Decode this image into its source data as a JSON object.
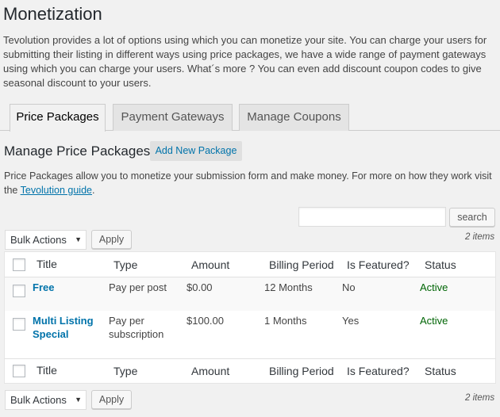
{
  "page": {
    "title": "Monetization",
    "intro": "Tevolution provides a lot of options using which you can monetize your site. You can charge your users for submitting their listing in different ways using price packages, we have a wide range of payment gateways using which you can charge your users. What´s more ? You can even add discount coupon codes to give seasonal discount to your users."
  },
  "tabs": [
    {
      "label": "Price Packages",
      "active": true
    },
    {
      "label": "Payment Gateways",
      "active": false
    },
    {
      "label": "Manage Coupons",
      "active": false
    }
  ],
  "section": {
    "title": "Manage Price Packages",
    "add_new_label": "Add New Package",
    "desc_prefix": "Price Packages allow you to monetize your submission form and make money. For more on how they work visit the ",
    "desc_link": "Tevolution guide",
    "desc_suffix": "."
  },
  "search": {
    "value": "",
    "button_label": "search"
  },
  "bulk": {
    "selected": "Bulk Actions",
    "apply_label": "Apply"
  },
  "count_label": "2 items",
  "table": {
    "columns": [
      "Title",
      "Type",
      "Amount",
      "Billing Period",
      "Is Featured?",
      "Status"
    ],
    "rows": [
      {
        "title": "Free",
        "type": "Pay per post",
        "amount": "$0.00",
        "billing": "12 Months",
        "featured": "No",
        "status": "Active"
      },
      {
        "title_line1": "Multi Listing",
        "title_line2": "Special",
        "type_line1": "Pay per",
        "type_line2": "subscription",
        "amount": "$100.00",
        "billing": "1 Months",
        "featured": "Yes",
        "status": "Active"
      }
    ]
  },
  "colors": {
    "accent": "#0073aa",
    "active_status": "#006505",
    "background": "#f1f1f1"
  }
}
